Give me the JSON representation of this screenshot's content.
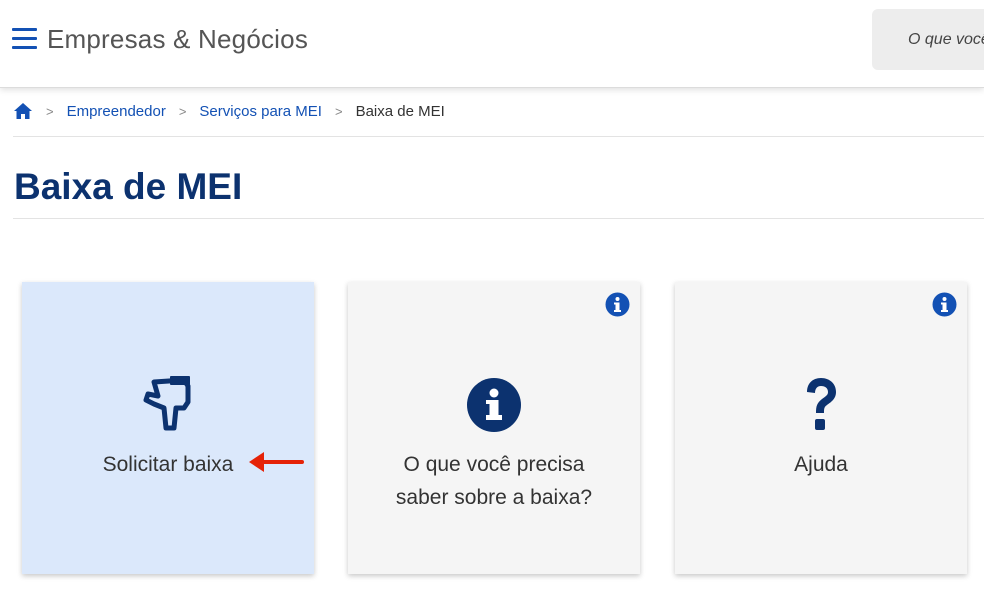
{
  "header": {
    "site_title": "Empresas & Negócios",
    "search_placeholder": "O que você"
  },
  "breadcrumb": {
    "items": [
      {
        "label": "Empreendedor"
      },
      {
        "label": "Serviços para MEI"
      }
    ],
    "separator": ">",
    "current": "Baixa de MEI"
  },
  "page": {
    "title": "Baixa de MEI"
  },
  "cards": [
    {
      "label": "Solicitar baixa",
      "icon": "hand-pointing-icon",
      "active": true
    },
    {
      "label_line1": "O que você precisa",
      "label_line2": "saber sobre a baixa?",
      "icon": "info-circle-icon"
    },
    {
      "label": "Ajuda",
      "icon": "question-mark-icon"
    }
  ],
  "colors": {
    "primary": "#1351b4",
    "title": "#0c326f",
    "icon_dark": "#0c326f",
    "card_bg": "#f5f5f5",
    "card_active_bg": "#dbe8fb",
    "annotation_arrow": "#e52207"
  }
}
